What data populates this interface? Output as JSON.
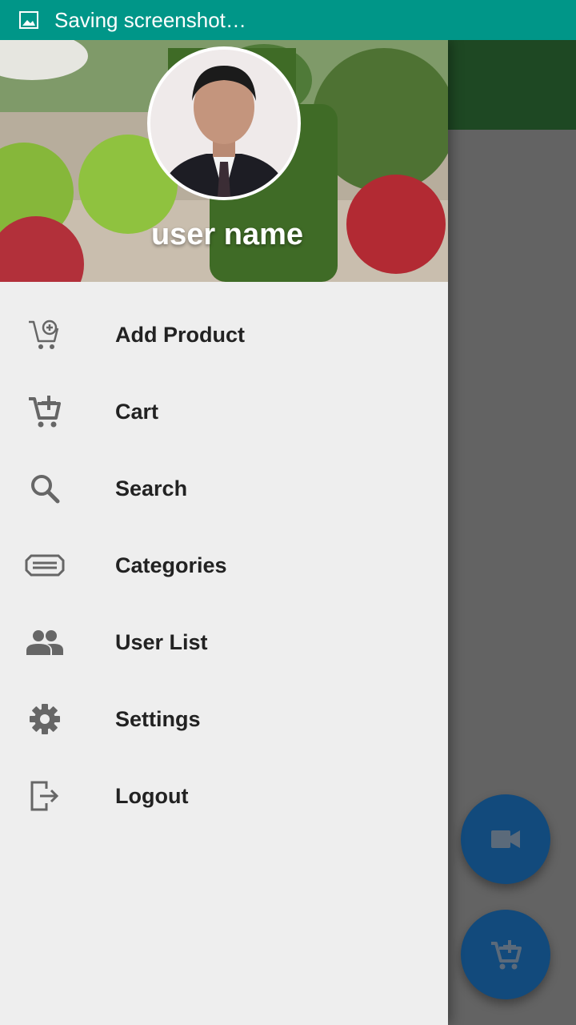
{
  "status_bar": {
    "text": "Saving screenshot…",
    "icon": "image-icon",
    "color": "#009688"
  },
  "drawer": {
    "header": {
      "user_name": "user name",
      "avatar": "avatar-photo"
    },
    "items": [
      {
        "label": "Add Product",
        "icon": "add-cart-icon"
      },
      {
        "label": "Cart",
        "icon": "cart-icon"
      },
      {
        "label": "Search",
        "icon": "search-icon"
      },
      {
        "label": "Categories",
        "icon": "categories-icon"
      },
      {
        "label": "User List",
        "icon": "people-icon"
      },
      {
        "label": "Settings",
        "icon": "gear-icon"
      },
      {
        "label": "Logout",
        "icon": "logout-icon"
      }
    ]
  },
  "fabs": [
    {
      "icon": "video-icon"
    },
    {
      "icon": "add-cart-icon"
    }
  ],
  "colors": {
    "toolbar": "#1e4823",
    "fab": "#124a7c",
    "drawer_bg": "#eeeeee",
    "icon": "#666666"
  }
}
